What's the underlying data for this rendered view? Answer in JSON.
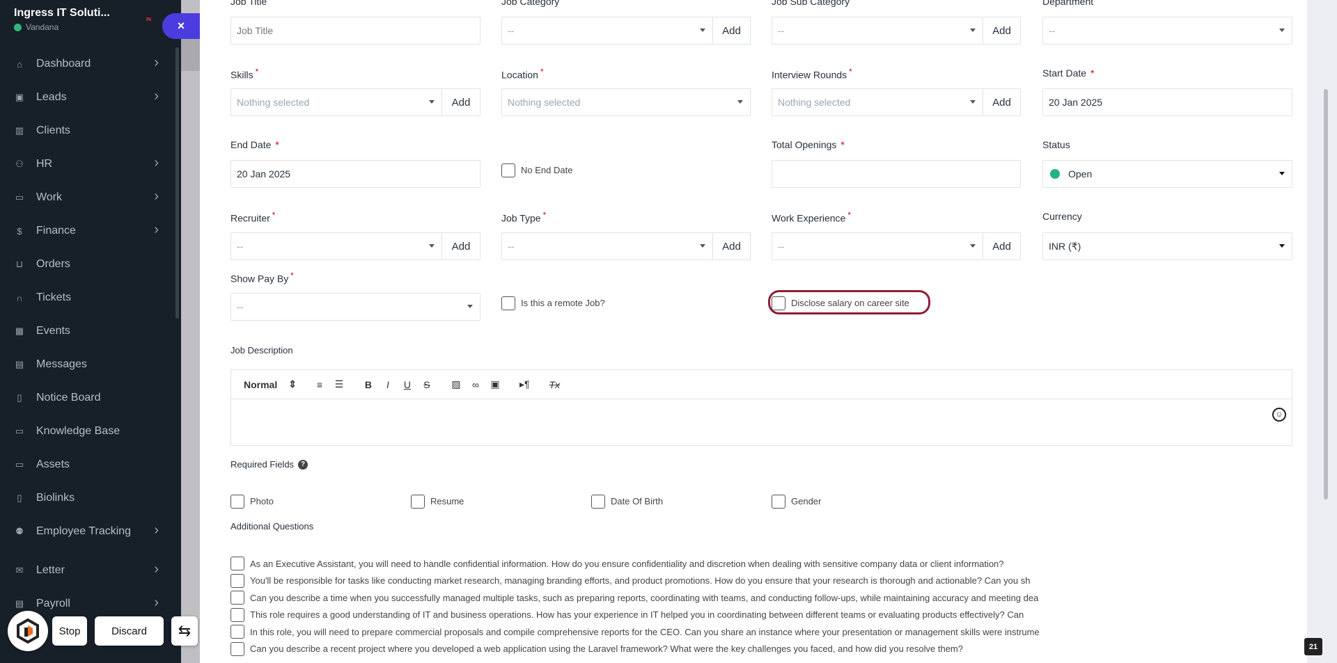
{
  "sidebar": {
    "company": "Ingress IT Soluti...",
    "user": "Vandana",
    "badge": "IN",
    "close_label": "×",
    "items": [
      {
        "label": "Dashboard",
        "icon": "home-icon",
        "glyph": "⌂",
        "chevron": true
      },
      {
        "label": "Leads",
        "icon": "contact-card-icon",
        "glyph": "▣",
        "chevron": true
      },
      {
        "label": "Clients",
        "icon": "building-icon",
        "glyph": "▥",
        "chevron": false
      },
      {
        "label": "HR",
        "icon": "people-icon",
        "glyph": "⚇",
        "chevron": true
      },
      {
        "label": "Work",
        "icon": "briefcase-icon",
        "glyph": "▭",
        "chevron": true
      },
      {
        "label": "Finance",
        "icon": "dollar-icon",
        "glyph": "$",
        "chevron": true
      },
      {
        "label": "Orders",
        "icon": "cart-icon",
        "glyph": "⊔",
        "chevron": false
      },
      {
        "label": "Tickets",
        "icon": "headset-icon",
        "glyph": "∩",
        "chevron": false
      },
      {
        "label": "Events",
        "icon": "calendar-icon",
        "glyph": "▦",
        "chevron": false
      },
      {
        "label": "Messages",
        "icon": "chat-icon",
        "glyph": "▤",
        "chevron": false
      },
      {
        "label": "Notice Board",
        "icon": "clipboard-icon",
        "glyph": "▯",
        "chevron": false
      },
      {
        "label": "Knowledge Base",
        "icon": "book-icon",
        "glyph": "▭",
        "chevron": false
      },
      {
        "label": "Assets",
        "icon": "monitor-icon",
        "glyph": "▭",
        "chevron": false
      },
      {
        "label": "Biolinks",
        "icon": "id-card-icon",
        "glyph": "▯",
        "chevron": false
      },
      {
        "label": "Employee Tracking",
        "icon": "tracking-icon",
        "glyph": "⚉",
        "chevron": true
      },
      {
        "label": "Letter",
        "icon": "envelope-icon",
        "glyph": "✉",
        "chevron": true
      },
      {
        "label": "Payroll",
        "icon": "payroll-icon",
        "glyph": "▤",
        "chevron": true
      }
    ]
  },
  "form": {
    "job_title": {
      "label": "Job Title",
      "placeholder": "Job Title"
    },
    "job_category": {
      "label": "Job Category",
      "value": "--",
      "add": "Add"
    },
    "job_sub_category": {
      "label": "Job Sub Category",
      "value": "--",
      "add": "Add"
    },
    "department": {
      "label": "Department",
      "value": "--"
    },
    "skills": {
      "label": "Skills",
      "value": "Nothing selected",
      "add": "Add",
      "required": "*"
    },
    "location": {
      "label": "Location",
      "value": "Nothing selected",
      "required": "*"
    },
    "interview_rounds": {
      "label": "Interview Rounds",
      "value": "Nothing selected",
      "add": "Add",
      "required": "*"
    },
    "start_date": {
      "label": "Start Date",
      "value": "20 Jan 2025",
      "required": "*"
    },
    "end_date": {
      "label": "End Date",
      "value": "20 Jan 2025",
      "required": "*"
    },
    "no_end_date": {
      "label": "No End Date"
    },
    "total_openings": {
      "label": "Total Openings",
      "value": "",
      "required": "*"
    },
    "status": {
      "label": "Status",
      "value": "Open",
      "dot_color": "#21b384"
    },
    "recruiter": {
      "label": "Recruiter",
      "value": "--",
      "add": "Add",
      "required": "*"
    },
    "job_type": {
      "label": "Job Type",
      "value": "--",
      "add": "Add",
      "required": "*"
    },
    "work_experience": {
      "label": "Work Experience",
      "value": "--",
      "add": "Add",
      "required": "*"
    },
    "currency": {
      "label": "Currency",
      "value": "INR (₹)"
    },
    "show_pay_by": {
      "label": "Show Pay By",
      "value": "--",
      "required": "*"
    },
    "remote_job": {
      "label": "Is this a remote Job?"
    },
    "disclose_salary": {
      "label": "Disclose salary on career site"
    },
    "job_description": {
      "label": "Job Description",
      "toolbar": {
        "format": "Normal",
        "format_caret": "⇕",
        "ordered_list": "≡",
        "bullet_list": "☰",
        "bold": "B",
        "italic": "I",
        "underline": "U",
        "strike": "S",
        "image": "▨",
        "link": "∞",
        "video": "▣",
        "rtl": "▸¶",
        "clear": "Tx"
      },
      "emoji": "☺"
    },
    "required_fields": {
      "label": "Required Fields",
      "help": "?",
      "options": [
        "Photo",
        "Resume",
        "Date Of Birth",
        "Gender"
      ]
    },
    "additional_questions": {
      "label": "Additional Questions",
      "items": [
        "As an Executive Assistant, you will need to handle confidential information. How do you ensure confidentiality and discretion when dealing with sensitive company data or client information?",
        "You'll be responsible for tasks like conducting market research, managing branding efforts, and product promotions. How do you ensure that your research is thorough and actionable? Can you sh",
        "Can you describe a time when you successfully managed multiple tasks, such as preparing reports, coordinating with teams, and conducting follow-ups, while maintaining accuracy and meeting dea",
        "This role requires a good understanding of IT and business operations. How has your experience in IT helped you in coordinating between different teams or evaluating products effectively? Can",
        "In this role, you will need to prepare commercial proposals and compile comprehensive reports for the CEO. Can you share an instance where your presentation or management skills were instrume",
        "Can you describe a recent project where you developed a web application using the Laravel framework? What were the key challenges you faced, and how did you resolve them?"
      ]
    }
  },
  "bottom_bar": {
    "stop": "Stop",
    "discard": "Discard",
    "swap_icon": "⇆"
  },
  "page_badge": "21",
  "colors": {
    "sidebar_bg": "#171f29",
    "accent": "#4b3ce0",
    "highlight": "#8d1f36",
    "required": "#d30000"
  }
}
